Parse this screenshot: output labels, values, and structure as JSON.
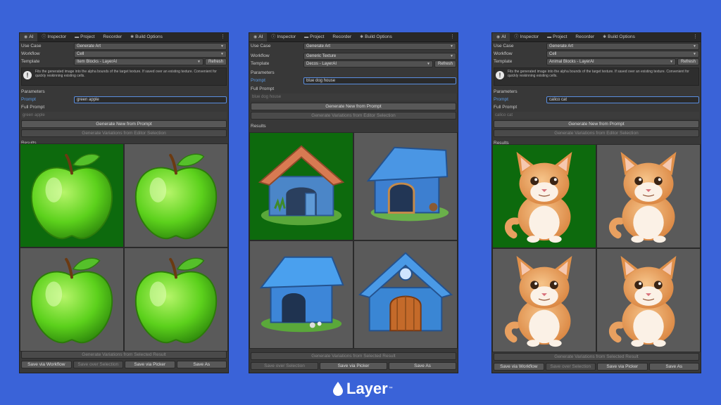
{
  "panels": [
    {
      "tabs": [
        "AI",
        "Inspector",
        "Project",
        "Recorder",
        "Build Options"
      ],
      "use_case_label": "Use Case",
      "use_case": "Generate Art",
      "workflow_label": "Workflow",
      "workflow": "Cell",
      "template_label": "Template",
      "template": "Item Blocks - LayerAI",
      "refresh": "Refresh",
      "info_text": "Fits the generated image into the alpha bounds of the target texture. If saved over an existing texture. Convenient for quickly reskinning existing cells.",
      "parameters": "Parameters",
      "prompt_label": "Prompt",
      "prompt": "green apple",
      "full_prompt_label": "Full Prompt",
      "full_prompt": "green apple",
      "generate_new": "Generate New from Prompt",
      "generate_variations_editor": "Generate Variations from Editor Selection",
      "results": "Results",
      "generate_variations_selected": "Generate Variations from Selected Result",
      "bottom_buttons": [
        "Save via Workflow",
        "Save over Selection",
        "Save via Picker",
        "Save As"
      ]
    },
    {
      "tabs": [
        "AI",
        "Inspector",
        "Project",
        "Recorder",
        "Build Options"
      ],
      "use_case_label": "Use Case",
      "use_case": "Generate Art",
      "workflow_label": "Workflow",
      "workflow": "Generic Texture",
      "template_label": "Template",
      "template": "Decos - LayerAI",
      "refresh": "Refresh",
      "parameters": "Parameters",
      "prompt_label": "Prompt",
      "prompt": "blue dog house",
      "full_prompt_label": "Full Prompt",
      "full_prompt": "blue dog house",
      "generate_new": "Generate New from Prompt",
      "generate_variations_editor": "Generate Variations from Editor Selection",
      "results": "Results",
      "generate_variations_selected": "Generate Variations from Selected Result",
      "bottom_buttons": [
        "Save over Selection",
        "Save via Picker",
        "Save As"
      ]
    },
    {
      "tabs": [
        "AI",
        "Inspector",
        "Project",
        "Recorder",
        "Build Options"
      ],
      "use_case_label": "Use Case",
      "use_case": "Generate Art",
      "workflow_label": "Workflow",
      "workflow": "Cell",
      "template_label": "Template",
      "template": "Animal Blocks - LayerAI",
      "refresh": "Refresh",
      "info_text": "Fits the generated image into the alpha bounds of the target texture. If saved over an existing texture. Convenient for quickly reskinning existing cells.",
      "parameters": "Parameters",
      "prompt_label": "Prompt",
      "prompt": "calico cat",
      "full_prompt_label": "Full Prompt",
      "full_prompt": "calico cat",
      "generate_new": "Generate New from Prompt",
      "generate_variations_editor": "Generate Variations from Editor Selection",
      "results": "Results",
      "generate_variations_selected": "Generate Variations from Selected Result",
      "bottom_buttons": [
        "Save via Workflow",
        "Save over Selection",
        "Save via Picker",
        "Save As"
      ]
    }
  ],
  "brand": {
    "name": "Layer",
    "mark": "™"
  },
  "colors": {
    "background": "#3a63d8",
    "selected_cell": "#0d6a0d",
    "prompt_accent": "#5a9ae6"
  }
}
